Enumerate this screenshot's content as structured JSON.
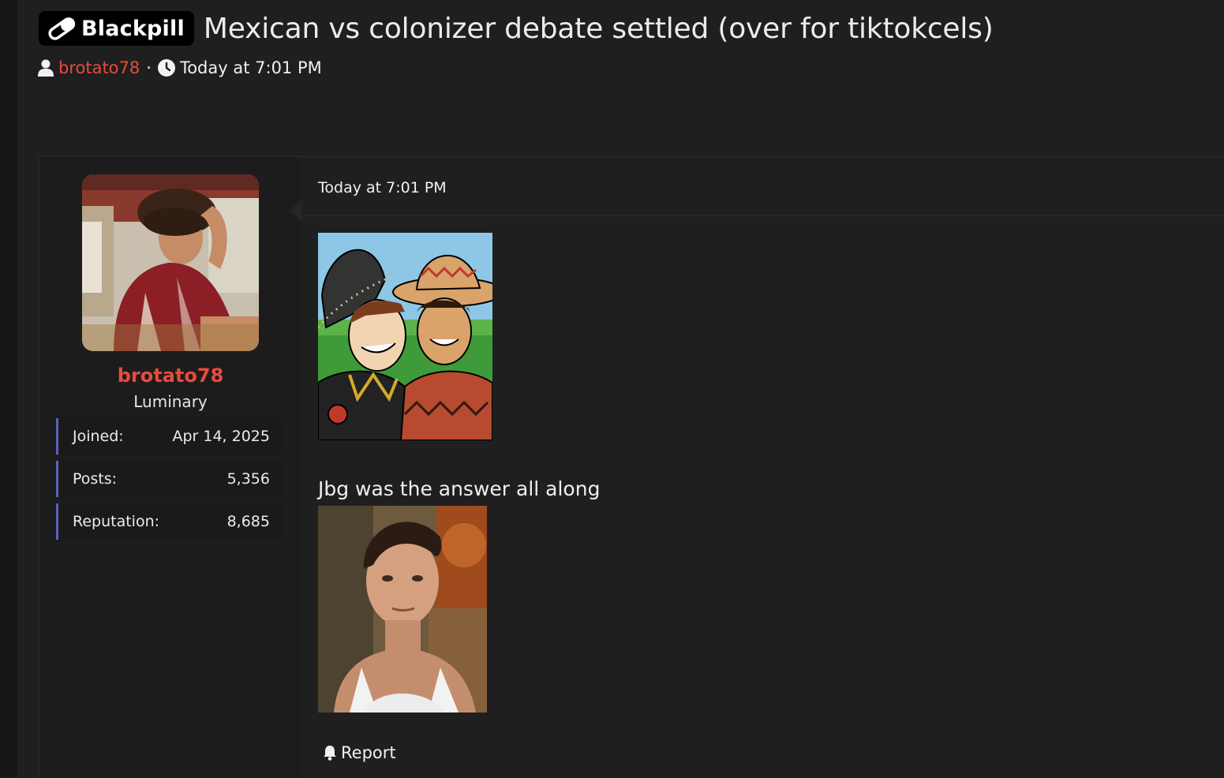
{
  "thread": {
    "prefix": "Blackpill",
    "title": "Mexican vs colonizer debate settled (over for tiktokcels)",
    "author": "brotato78",
    "date": "Today at 7:01 PM"
  },
  "user": {
    "name": "brotato78",
    "title": "Luminary",
    "stats": [
      {
        "label": "Joined:",
        "value": "Apr 14, 2025"
      },
      {
        "label": "Posts:",
        "value": "5,356"
      },
      {
        "label": "Reputation:",
        "value": "8,685"
      }
    ]
  },
  "post": {
    "date": "Today at 7:01 PM",
    "caption": "Jbg was the answer all along",
    "report_label": "Report"
  },
  "colors": {
    "accent_red": "#ea4a3c",
    "stat_border": "#5a63bd",
    "background": "#1f1f1f"
  },
  "icons": {
    "prefix": "pill-logo-icon",
    "author": "user-icon",
    "date": "clock-icon",
    "report": "bell-icon"
  }
}
